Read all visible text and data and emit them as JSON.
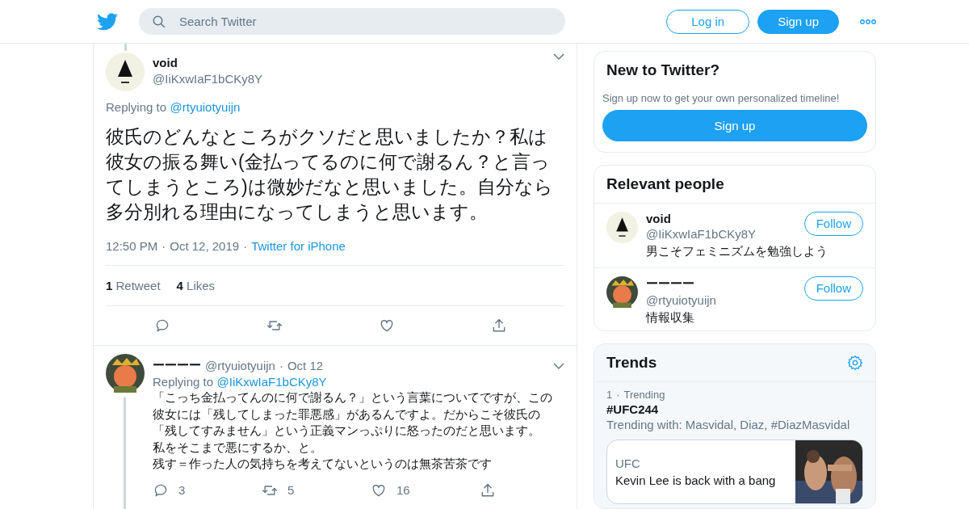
{
  "header": {
    "search_placeholder": "Search Twitter",
    "login": "Log in",
    "signup": "Sign up"
  },
  "main_tweet": {
    "name": "void",
    "handle": "@IiKxwIaF1bCKy8Y",
    "replying_label": "Replying to",
    "replying_to": "@rtyuiotyuijn",
    "text": "彼氏のどんなところがクソだと思いましたか？私は彼女の振る舞い(金払ってるのに何で謝るん？と言ってしまうところ)は微妙だなと思いました。自分なら多分別れる理由になってしまうと思います。",
    "time": "12:50 PM",
    "date": "Oct 12, 2019",
    "source": "Twitter for iPhone",
    "separator": "·",
    "retweets": "1",
    "retweets_label": "Retweet",
    "likes": "4",
    "likes_label": "Likes"
  },
  "reply": {
    "name": "ーーーー",
    "handle": "@rtyuiotyuijn",
    "separator": "·",
    "date": "Oct 12",
    "replying_label": "Replying to",
    "replying_to": "@IiKxwIaF1bCKy8Y",
    "lines": [
      "「こっち金払ってんのに何で謝るん？」という言葉についてですが、この",
      "彼女には「残してしまった罪悪感」があるんですよ。だからこそ彼氏の",
      "「残してすみません」という正義マンっぷりに怒ったのだと思います。",
      "私をそこまで悪にするか、と。",
      "残す＝作った人の気持ちを考えてないというのは無茶苦茶です"
    ],
    "replies": "3",
    "retweets": "5",
    "likes": "16"
  },
  "signup_card": {
    "title": "New to Twitter?",
    "subtitle": "Sign up now to get your own personalized timeline!",
    "button": "Sign up"
  },
  "relevant_people": {
    "title": "Relevant people",
    "people": [
      {
        "name": "void",
        "handle": "@IiKxwIaF1bCKy8Y",
        "bio": "男こそフェミニズムを勉強しよう",
        "follow": "Follow"
      },
      {
        "name": "ーーーー",
        "handle": "@rtyuiotyuijn",
        "bio": "情報収集",
        "follow": "Follow"
      }
    ]
  },
  "trends": {
    "title": "Trends",
    "items": [
      {
        "rank": "1",
        "separator": "·",
        "context": "Trending",
        "tag": "#UFC244",
        "with": "Trending with: Masvidal, Diaz, #DiazMasvidal",
        "card": {
          "source": "UFC",
          "headline": "Kevin Lee is back with a bang",
          "kind": "picture"
        }
      }
    ]
  }
}
